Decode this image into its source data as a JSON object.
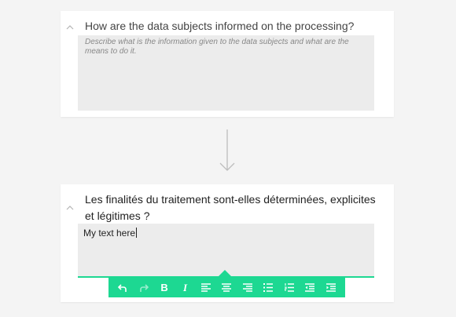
{
  "card1": {
    "question": "How are the data subjects informed on the processing?",
    "placeholder": "Describe what is the information given to the data subjects and what are the means to do it."
  },
  "card2": {
    "question": "Les finalités du traitement sont-elles déterminées, explicites et légitimes ?",
    "text": "My text here"
  },
  "toolbar": {
    "bold_label": "B",
    "italic_label": "I",
    "buttons": [
      "undo-icon",
      "redo-icon",
      "bold",
      "italic",
      "align-left-icon",
      "align-center-icon",
      "align-right-icon",
      "bulleted-list-icon",
      "numbered-list-icon",
      "outdent-icon",
      "indent-icon"
    ]
  },
  "colors": {
    "accent": "#1dd892",
    "background": "#f4f4f4",
    "field": "#ececec"
  }
}
